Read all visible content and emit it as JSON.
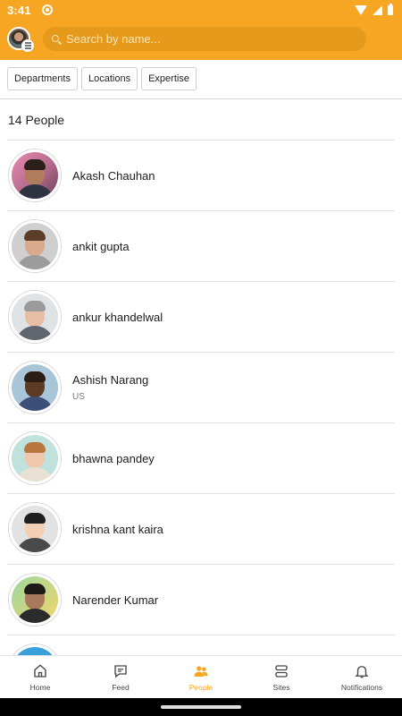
{
  "status_bar": {
    "time": "3:41"
  },
  "search": {
    "placeholder": "Search by name..."
  },
  "filters": [
    "Departments",
    "Locations",
    "Expertise"
  ],
  "people_count": "14 People",
  "people": [
    {
      "name": "Akash Chauhan",
      "location": ""
    },
    {
      "name": "ankit gupta",
      "location": ""
    },
    {
      "name": "ankur khandelwal",
      "location": ""
    },
    {
      "name": "Ashish Narang",
      "location": "US"
    },
    {
      "name": "bhawna pandey",
      "location": ""
    },
    {
      "name": "krishna kant kaira",
      "location": ""
    },
    {
      "name": "Narender Kumar",
      "location": ""
    }
  ],
  "nav": [
    {
      "label": "Home",
      "icon": "home-icon"
    },
    {
      "label": "Feed",
      "icon": "chat-icon"
    },
    {
      "label": "People",
      "icon": "people-icon",
      "active": true
    },
    {
      "label": "Sites",
      "icon": "sites-icon"
    },
    {
      "label": "Notifications",
      "icon": "bell-icon"
    }
  ],
  "colors": {
    "accent": "#f7a623",
    "search_bg": "#e59a1b"
  }
}
